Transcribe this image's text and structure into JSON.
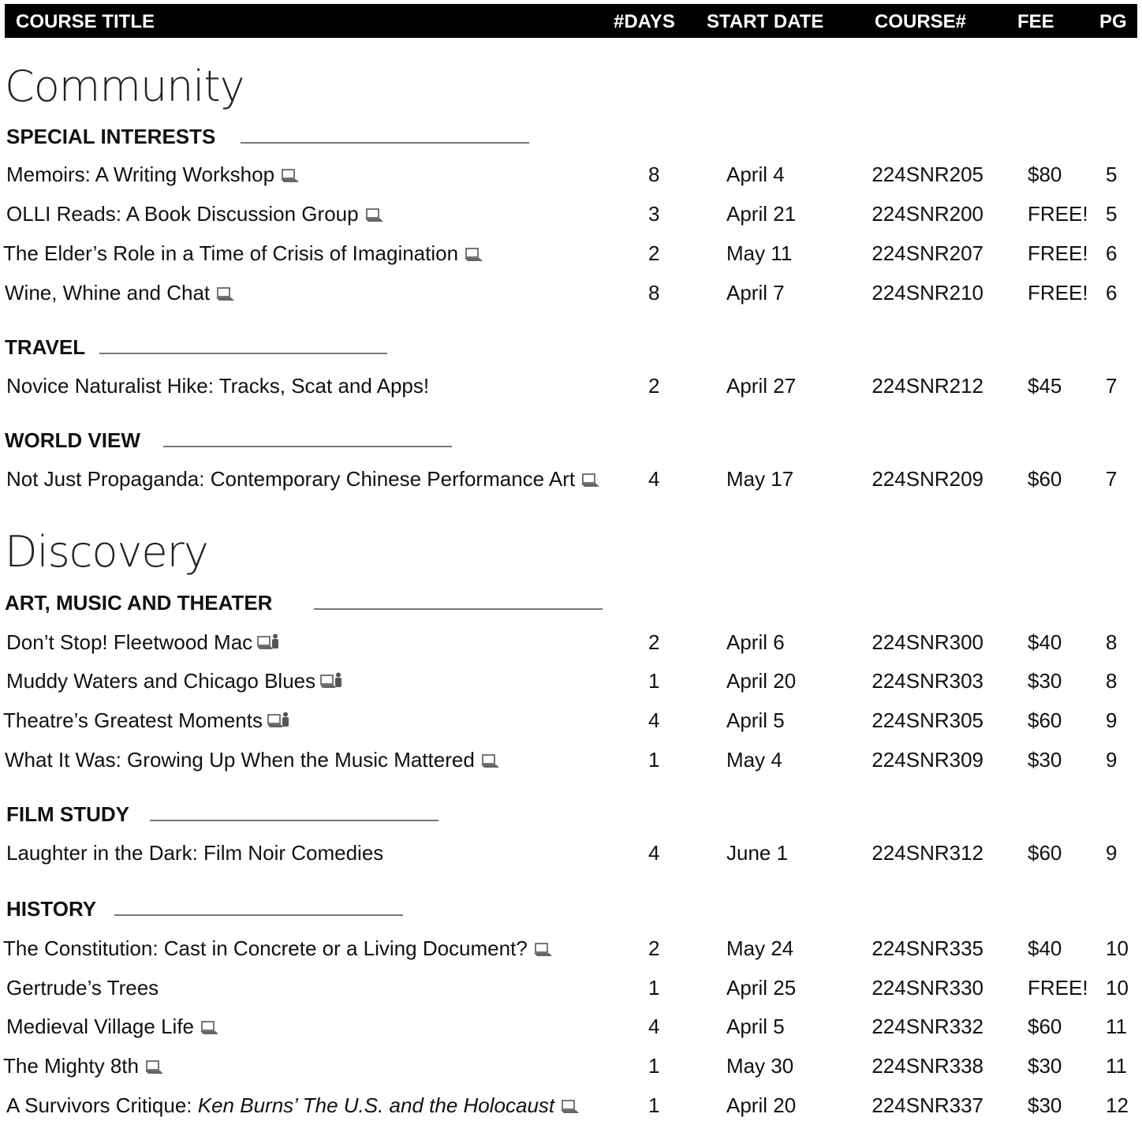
{
  "header": {
    "title": "COURSE TITLE",
    "days": "#DAYS",
    "start": "START DATE",
    "course": "COURSE#",
    "fee": "FEE",
    "pg": "PG"
  },
  "sections": {
    "community": "Community",
    "discovery": "Discovery"
  },
  "categories": {
    "special": "SPECIAL INTERESTS",
    "travel": "TRAVEL",
    "world": "WORLD VIEW",
    "art": "ART, MUSIC AND THEATER",
    "film": "FILM STUDY",
    "history": "HISTORY"
  },
  "rows": [
    {
      "title": "Memoirs: A Writing Workshop",
      "icon": "laptop-icon",
      "days": "8",
      "date": "April 4",
      "num": "224SNR205",
      "fee": "$80",
      "pg": "5"
    },
    {
      "title": "OLLI Reads: A Book Discussion Group",
      "icon": "laptop-icon",
      "days": "3",
      "date": "April 21",
      "num": "224SNR200",
      "fee": "FREE!",
      "pg": "5"
    },
    {
      "title": "The Elder’s Role in a Time of Crisis of Imagination",
      "icon": "laptop-icon",
      "days": "2",
      "date": "May 11",
      "num": "224SNR207",
      "fee": "FREE!",
      "pg": "6"
    },
    {
      "title": "Wine, Whine and Chat",
      "icon": "laptop-icon",
      "days": "8",
      "date": "April 7",
      "num": "224SNR210",
      "fee": "FREE!",
      "pg": "6"
    },
    {
      "title": "Novice Naturalist Hike: Tracks, Scat and Apps!",
      "icon": "",
      "days": "2",
      "date": "April 27",
      "num": "224SNR212",
      "fee": "$45",
      "pg": "7"
    },
    {
      "title": "Not Just Propaganda: Contemporary Chinese Performance Art",
      "icon": "laptop-icon",
      "days": "4",
      "date": "May 17",
      "num": "224SNR209",
      "fee": "$60",
      "pg": "7"
    },
    {
      "title": "Don’t Stop! Fleetwood Mac",
      "icon": "hybrid-icon",
      "days": "2",
      "date": "April 6",
      "num": "224SNR300",
      "fee": "$40",
      "pg": "8"
    },
    {
      "title": "Muddy Waters and Chicago Blues",
      "icon": "hybrid-icon",
      "days": "1",
      "date": "April 20",
      "num": "224SNR303",
      "fee": "$30",
      "pg": "8"
    },
    {
      "title": "Theatre’s Greatest Moments",
      "icon": "hybrid-icon",
      "days": "4",
      "date": "April 5",
      "num": "224SNR305",
      "fee": "$60",
      "pg": "9"
    },
    {
      "title": "What It Was: Growing Up When the Music Mattered",
      "icon": "laptop-icon",
      "days": "1",
      "date": "May 4",
      "num": "224SNR309",
      "fee": "$30",
      "pg": "9"
    },
    {
      "title": "Laughter in the Dark: Film Noir Comedies",
      "icon": "",
      "days": "4",
      "date": "June 1",
      "num": "224SNR312",
      "fee": "$60",
      "pg": "9"
    },
    {
      "title": "The Constitution: Cast in Concrete or a Living Document?",
      "icon": "laptop-icon",
      "days": "2",
      "date": "May 24",
      "num": "224SNR335",
      "fee": "$40",
      "pg": "10"
    },
    {
      "title": "Gertrude’s Trees",
      "icon": "",
      "days": "1",
      "date": "April 25",
      "num": "224SNR330",
      "fee": "FREE!",
      "pg": "10"
    },
    {
      "title": "Medieval Village Life",
      "icon": "laptop-icon",
      "days": "4",
      "date": "April 5",
      "num": "224SNR332",
      "fee": "$60",
      "pg": "11"
    },
    {
      "title": "The Mighty 8th",
      "icon": "laptop-icon",
      "days": "1",
      "date": "May 30",
      "num": "224SNR338",
      "fee": "$30",
      "pg": "11"
    },
    {
      "title_prefix": "A Survivors Critique: ",
      "title_italic": "Ken Burns’ The U.S. and the Holocaust",
      "icon": "laptop-icon",
      "days": "1",
      "date": "April 20",
      "num": "224SNR337",
      "fee": "$30",
      "pg": "12"
    }
  ]
}
